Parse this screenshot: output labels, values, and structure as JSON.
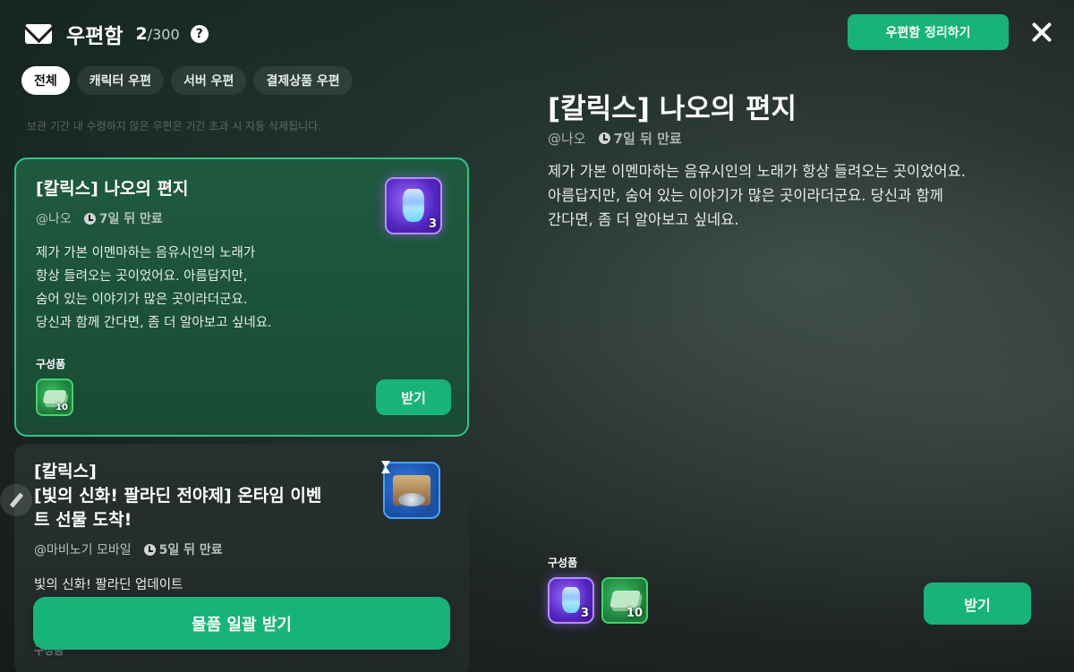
{
  "header": {
    "title": "우편함",
    "count": "2",
    "count_max": "/300",
    "help": "?",
    "organize_label": "우편함 정리하기"
  },
  "tabs": [
    {
      "label": "전체",
      "active": true
    },
    {
      "label": "캐릭터 우편",
      "active": false
    },
    {
      "label": "서버 우편",
      "active": false
    },
    {
      "label": "결제상품 우편",
      "active": false
    }
  ],
  "notice": "보관 기간 내 수령하지 않은 우편은 기간 초과 시 자동 삭제됩니다.",
  "mails": [
    {
      "title": "[칼릭스] 나오의 편지",
      "sender": "@나오",
      "expiry": "7일 뒤 만료",
      "body": [
        "제가 가본 이멘마하는 음유시인의 노래가",
        "항상 들려오는 곳이었어요. 아름답지만,",
        "숨어 있는 이야기가 많은 곳이라더군요.",
        "당신과 함께 간다면, 좀 더 알아보고 싶네요."
      ],
      "components_label": "구성품",
      "main_item_qty": "3",
      "component_qty": "10",
      "receive_label": "받기"
    },
    {
      "title_line1": "[칼릭스]",
      "title_line2": "[빛의 신화! 팔라딘 전야제] 온타임 이벤",
      "title_line3": "트 선물 도착!",
      "sender": "@마비노기 모바일",
      "expiry": "5일 뒤 만료",
      "body": "빛의 신화! 팔라딘 업데이트",
      "components_label": "구성품"
    }
  ],
  "bulk_receive_label": "물품 일괄 받기",
  "detail": {
    "title": "[칼릭스] 나오의 편지",
    "sender": "@나오",
    "expiry": "7일 뒤 만료",
    "body": [
      "제가 가본 이멘마하는 음유시인의 노래가 항상 들려오는 곳이었어요.",
      "아름답지만, 숨어 있는 이야기가 많은 곳이라더군요. 당신과 함께",
      "간다면, 좀 더 알아보고 싶네요."
    ],
    "components_label": "구성품",
    "items": [
      {
        "icon": "potion-icon",
        "qty": "3"
      },
      {
        "icon": "cash-icon",
        "qty": "10"
      }
    ],
    "receive_label": "받기"
  },
  "colors": {
    "accent": "#17b47a",
    "selected_border": "#2cc68a",
    "rare_item": "#5426c2",
    "common_item": "#1d7d3a",
    "event_item": "#1a4fa6"
  }
}
